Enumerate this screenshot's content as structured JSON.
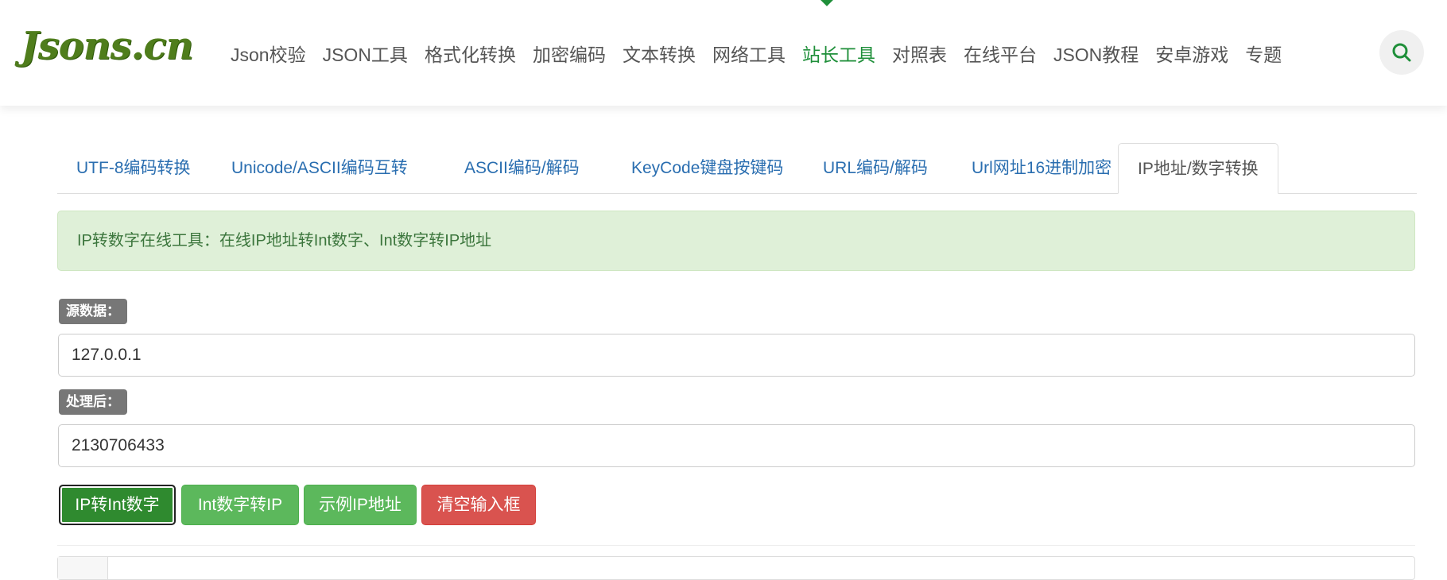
{
  "header": {
    "logo_text": "Jsons.cn",
    "nav": [
      {
        "label": "Json校验"
      },
      {
        "label": "JSON工具"
      },
      {
        "label": "格式化转换"
      },
      {
        "label": "加密编码"
      },
      {
        "label": "文本转换"
      },
      {
        "label": "网络工具"
      },
      {
        "label": "站长工具",
        "active": true
      },
      {
        "label": "对照表"
      },
      {
        "label": "在线平台"
      },
      {
        "label": "JSON教程"
      },
      {
        "label": "安卓游戏"
      },
      {
        "label": "专题"
      }
    ],
    "search_icon": "search-icon",
    "accent_color": "#1f8f3a"
  },
  "tabs": [
    {
      "label": "UTF-8编码转换"
    },
    {
      "label": "Unicode/ASCII编码互转"
    },
    {
      "label": "ASCII编码/解码"
    },
    {
      "label": "KeyCode键盘按键码"
    },
    {
      "label": "URL编码/解码"
    },
    {
      "label": "Url网址16进制加密"
    },
    {
      "label": "IP地址/数字转换",
      "active": true
    }
  ],
  "alert": {
    "text": "IP转数字在线工具：在线IP地址转Int数字、Int数字转IP地址"
  },
  "form": {
    "source_label": "源数据：",
    "source_value": "127.0.0.1",
    "result_label": "处理后：",
    "result_value": "2130706433"
  },
  "buttons": {
    "ip_to_int": "IP转Int数字",
    "int_to_ip": "Int数字转IP",
    "example_ip": "示例IP地址",
    "clear": "清空输入框"
  },
  "colors": {
    "button_green": "#5cb85c",
    "button_green_pressed": "#2f8a2f",
    "button_red": "#d9534f",
    "tab_link": "#2a6eb0",
    "alert_bg": "#dff0d8",
    "alert_text": "#3c763d"
  }
}
